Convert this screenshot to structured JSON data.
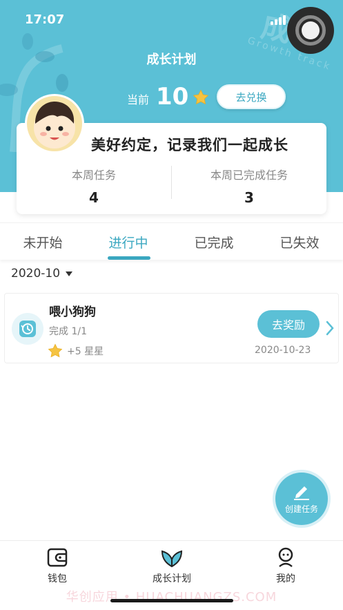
{
  "status_bar": {
    "time": "17:07"
  },
  "header": {
    "title": "成长计划",
    "current_label": "当前",
    "current_value": "10",
    "redeem_label": "去兑换"
  },
  "summary": {
    "slogan": "美好约定，记录我们一起成长",
    "week_tasks_label": "本周任务",
    "week_tasks_value": "4",
    "week_done_label": "本周已完成任务",
    "week_done_value": "3"
  },
  "tabs": [
    {
      "label": "未开始",
      "active": false
    },
    {
      "label": "进行中",
      "active": true
    },
    {
      "label": "已完成",
      "active": false
    },
    {
      "label": "已失效",
      "active": false
    }
  ],
  "month_filter": {
    "value": "2020-10"
  },
  "tasks": [
    {
      "name": "喂小狗狗",
      "progress": "完成 1/1",
      "reward": "+5 星星",
      "action_label": "去奖励",
      "date": "2020-10-23"
    }
  ],
  "fab": {
    "label": "创建任务"
  },
  "bottom_nav": [
    {
      "label": "钱包",
      "icon": "wallet-icon"
    },
    {
      "label": "成长计划",
      "icon": "sprout-icon",
      "active": true
    },
    {
      "label": "我的",
      "icon": "profile-icon"
    }
  ],
  "watermark": "华创应用 • HUACHUANGZS.COM",
  "colors": {
    "accent": "#5bc0d6",
    "accent_dark": "#3aa7c0",
    "star": "#f5c342"
  }
}
